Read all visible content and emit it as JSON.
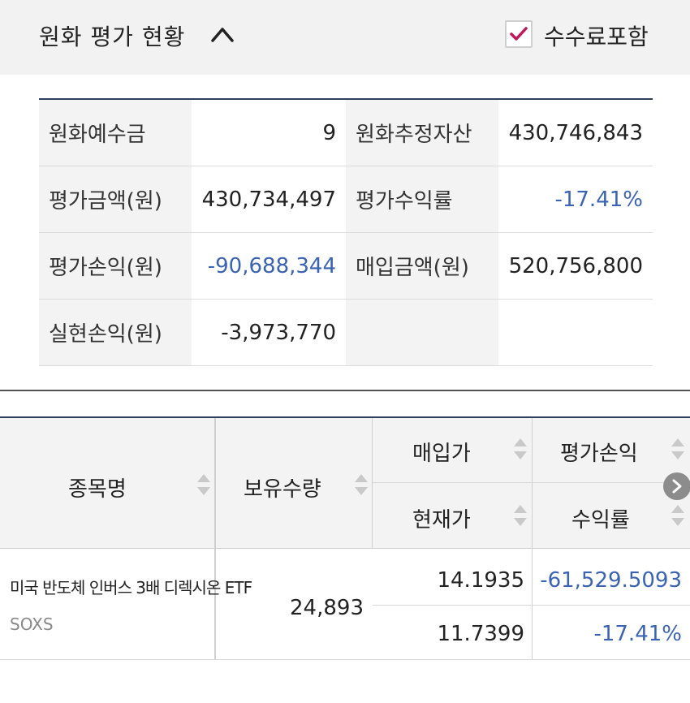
{
  "header": {
    "title": "원화 평가 현황",
    "fee_label": "수수료포함",
    "fee_checked": true,
    "colors": {
      "check": "#c2185b",
      "header_bg": "#f2f2f2"
    }
  },
  "summary": {
    "rows": [
      {
        "l1": "원화예수금",
        "v1": "9",
        "l2": "원화추정자산",
        "v2": "430,746,843"
      },
      {
        "l1": "평가금액(원)",
        "v1": "430,734,497",
        "l2": "평가수익률",
        "v2": "-17.41%"
      },
      {
        "l1": "평가손익(원)",
        "v1": "-90,688,344",
        "l2": "매입금액(원)",
        "v2": "520,756,800"
      },
      {
        "l1": "실현손익(원)",
        "v1": "-3,973,770",
        "l2": "",
        "v2": ""
      }
    ],
    "colors": {
      "negative": "#3a63b4"
    }
  },
  "holdings": {
    "columns": {
      "name": "종목명",
      "qty": "보유수량",
      "buy_price": "매입가",
      "current_price": "현재가",
      "pnl": "평가손익",
      "return": "수익률"
    },
    "rows": [
      {
        "name": "미국 반도체 인버스 3배 디렉시온 ETF",
        "ticker": "SOXS",
        "qty": "24,893",
        "buy_price": "14.1935",
        "current_price": "11.7399",
        "pnl": "-61,529.5093",
        "return": "-17.41%"
      }
    ]
  }
}
